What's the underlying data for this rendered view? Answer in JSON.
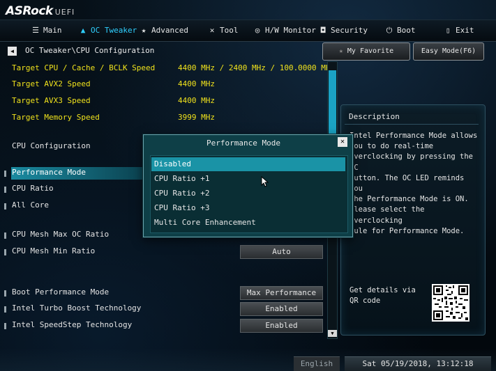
{
  "brand": {
    "name": "ASRock",
    "suffix": "UEFI"
  },
  "menu": [
    {
      "label": "Main",
      "icon": "list-icon"
    },
    {
      "label": "OC Tweaker",
      "icon": "rocket-icon",
      "active": true
    },
    {
      "label": "Advanced",
      "icon": "star-icon"
    },
    {
      "label": "Tool",
      "icon": "tools-icon"
    },
    {
      "label": "H/W Monitor",
      "icon": "globe-icon"
    },
    {
      "label": "Security",
      "icon": "shield-icon"
    },
    {
      "label": "Boot",
      "icon": "power-icon"
    },
    {
      "label": "Exit",
      "icon": "exit-door-icon"
    }
  ],
  "breadcrumb": "OC Tweaker\\CPU Configuration",
  "buttons": {
    "favorite": "My Favorite",
    "easy_mode": "Easy Mode(F6)"
  },
  "targets": [
    {
      "label": "Target CPU / Cache / BCLK Speed",
      "value": "4400 MHz / 2400 MHz / 100.0000 MHz"
    },
    {
      "label": "Target AVX2 Speed",
      "value": "4400 MHz"
    },
    {
      "label": "Target AVX3 Speed",
      "value": "4400 MHz"
    },
    {
      "label": "Target Memory Speed",
      "value": "3999 MHz"
    }
  ],
  "section_title": "CPU Configuration",
  "settings": [
    {
      "label": "Performance Mode"
    },
    {
      "label": "CPU Ratio"
    },
    {
      "label": "All Core"
    },
    {
      "label": "CPU Mesh Max OC Ratio"
    },
    {
      "label": "CPU Mesh Min Ratio",
      "value": "Auto"
    },
    {
      "label": "Boot Performance Mode",
      "value": "Max Performance"
    },
    {
      "label": "Intel Turbo Boost Technology",
      "value": "Enabled"
    },
    {
      "label": "Intel SpeedStep Technology",
      "value": "Enabled"
    }
  ],
  "description": {
    "title": "Description",
    "text": "Intel Performance Mode allows\nyou to do real-time\noverclocking by pressing the OC\nbutton. The OC LED reminds you\nthe Performance Mode is ON.\nPlease select the overclocking\nrule for Performance Mode.",
    "qr_text": "Get details via QR code"
  },
  "modal": {
    "title": "Performance Mode",
    "close": "✕",
    "options": [
      "Disabled",
      "CPU Ratio +1",
      "CPU Ratio +2",
      "CPU Ratio +3",
      "Multi Core Enhancement"
    ],
    "selected_index": 0
  },
  "footer": {
    "language": "English",
    "datetime": "Sat 05/19/2018, 13:12:18"
  }
}
